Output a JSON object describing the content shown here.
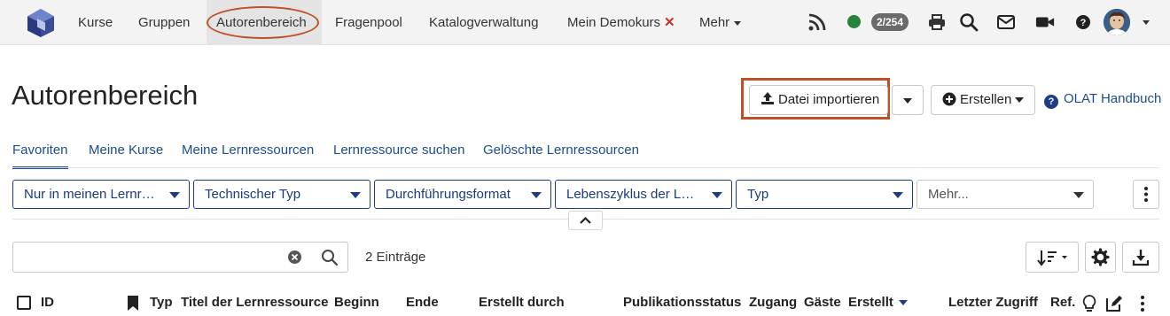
{
  "nav": {
    "items": [
      {
        "label": "Kurse"
      },
      {
        "label": "Gruppen"
      },
      {
        "label": "Autorenbereich"
      },
      {
        "label": "Fragenpool"
      },
      {
        "label": "Katalogverwaltung"
      },
      {
        "label": "Mein Demokurs",
        "close": "✕"
      },
      {
        "label": "Mehr"
      }
    ],
    "badge": "2/254",
    "icons": [
      "rss-icon",
      "online-status-icon",
      "print-icon",
      "search-icon",
      "mail-icon",
      "video-icon",
      "help-icon",
      "avatar"
    ]
  },
  "page": {
    "title": "Autorenbereich"
  },
  "actions": {
    "import_label": "Datei importieren",
    "create_label": "Erstellen",
    "help_label": "OLAT Handbuch"
  },
  "tabs": [
    {
      "label": "Favoriten"
    },
    {
      "label": "Meine Kurse"
    },
    {
      "label": "Meine Lernressourcen"
    },
    {
      "label": "Lernressource suchen"
    },
    {
      "label": "Gelöschte Lernressourcen"
    }
  ],
  "filters": [
    {
      "label": "Nur in meinen Lernressourcen"
    },
    {
      "label": "Technischer Typ"
    },
    {
      "label": "Durchführungsformat"
    },
    {
      "label": "Lebenszyklus der Lernressource"
    },
    {
      "label": "Typ"
    },
    {
      "label": "Mehr..."
    }
  ],
  "search": {
    "value": "",
    "placeholder": ""
  },
  "entries_label": "2 Einträge",
  "table": {
    "columns": [
      {
        "label": "ID"
      },
      {
        "label": "Typ"
      },
      {
        "label": "Titel der Lernressource"
      },
      {
        "label": "Beginn"
      },
      {
        "label": "Ende"
      },
      {
        "label": "Erstellt durch"
      },
      {
        "label": "Publikationsstatus"
      },
      {
        "label": "Zugang"
      },
      {
        "label": "Gäste"
      },
      {
        "label": "Erstellt"
      },
      {
        "label": "Letzter Zugriff"
      },
      {
        "label": "Ref."
      }
    ],
    "sorted_column": "Erstellt"
  },
  "colors": {
    "accent": "#1f3c88",
    "link": "#1d4b8f",
    "highlight": "#c0502a",
    "online": "#27823b",
    "close": "#c9302c"
  }
}
